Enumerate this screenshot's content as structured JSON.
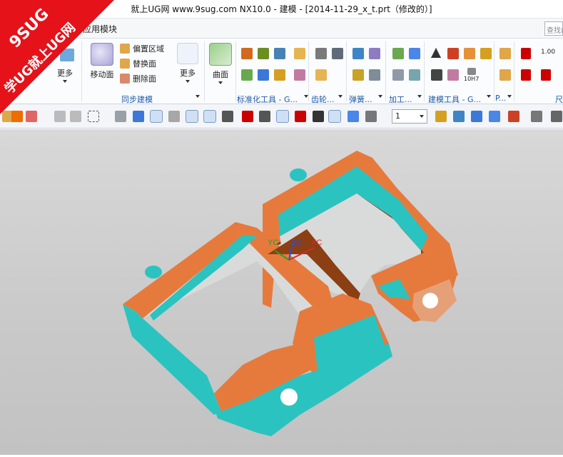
{
  "window": {
    "title": "就上UG网 www.9sug.com NX10.0 - 建模 - [2014-11-29_x_t.prt（修改的）]"
  },
  "menu": {
    "app_modules": "应用模块",
    "search_placeholder": "查找命令"
  },
  "ribbon": {
    "more_left": "更多",
    "move_face": "移动面",
    "offset_region": "偏置区域",
    "replace_face": "替换面",
    "delete_face": "删除面",
    "more_sync": "更多",
    "surface": "曲面",
    "groups": {
      "sync_modeling": "同步建模",
      "standard_tools": "标准化工具 - G...",
      "gear": "齿轮...",
      "spring": "弹簧...",
      "machining": "加工...",
      "modeling_tools": "建模工具 - G...",
      "p_group": "P...",
      "dimension": "尺"
    },
    "dim_value": "1.00",
    "tolerance_label": "10H7"
  },
  "toolbar2": {
    "layer_value": "1"
  },
  "viewport": {
    "axis_labels": {
      "yc": "YC",
      "zc": "ZC",
      "xc": "XC"
    }
  },
  "watermark": {
    "line1": "9SUG",
    "line2": "学UG就上UG网"
  },
  "colors": {
    "part_orange": "#e67a3c",
    "part_cyan": "#2bc3c0",
    "part_brown": "#8b3f13",
    "accent_blue": "#1d5aa8",
    "watermark_red": "#e5121a"
  }
}
